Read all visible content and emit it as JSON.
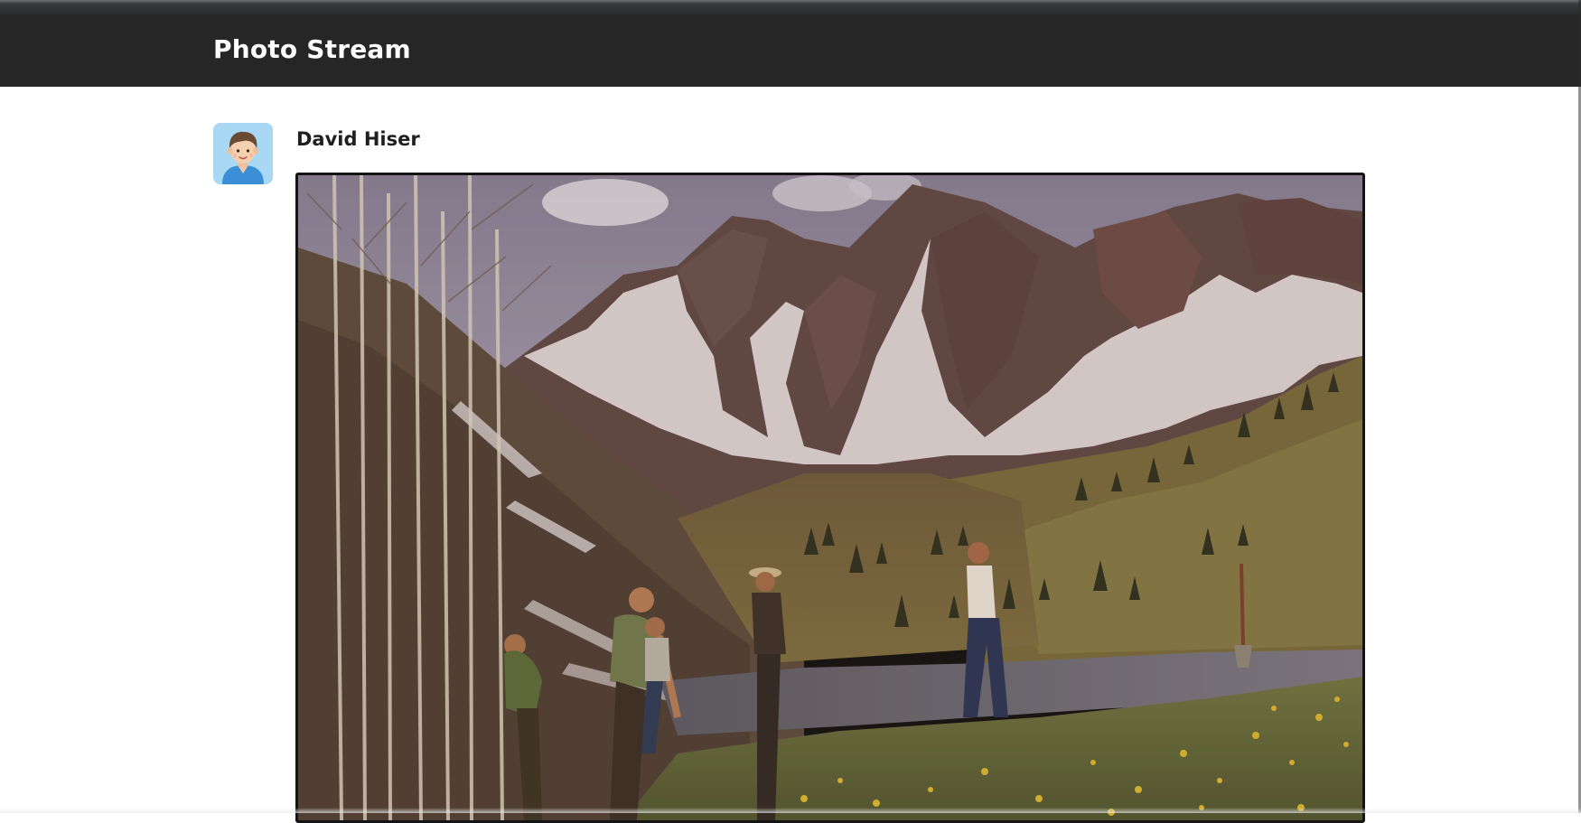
{
  "header": {
    "brand": "Photo Stream"
  },
  "post": {
    "author": "David Hiser",
    "avatar_icon": "user-avatar-icon",
    "photo_subject": "mountain-landscape-photo"
  },
  "colors": {
    "header_bg": "#262626",
    "header_text": "#ffffff",
    "page_bg": "#ffffff",
    "avatar_bg": "#a9d8f5",
    "author_text": "#1f1f1f"
  }
}
